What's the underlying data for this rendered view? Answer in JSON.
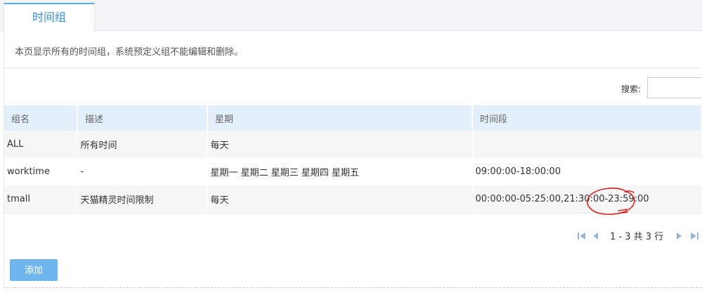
{
  "tabs": [
    {
      "label": "时间组"
    }
  ],
  "description": "本页显示所有的时间组，系统预定义组不能编辑和删除。",
  "search": {
    "label": "搜索:",
    "value": ""
  },
  "table": {
    "headers": [
      "组名",
      "描述",
      "星期",
      "时间段"
    ],
    "rows": [
      {
        "name": "ALL",
        "desc": "所有时间",
        "week": "每天",
        "time": ""
      },
      {
        "name": "worktime",
        "desc": "-",
        "week": "星期一 星期二 星期三 星期四 星期五",
        "time": "09:00:00-18:00:00"
      },
      {
        "name": "tmall",
        "desc": "天猫精灵时间限制",
        "week": "每天",
        "time": "00:00:00-05:25:00,21:30:00-23:59:00"
      }
    ]
  },
  "pager": {
    "text": "1 - 3 共 3 行"
  },
  "add_button": "添加",
  "colors": {
    "accent": "#3a91d8",
    "header_bg": "#e3f0fb",
    "button": "#6fb6ee",
    "annotation": "#e02020"
  }
}
